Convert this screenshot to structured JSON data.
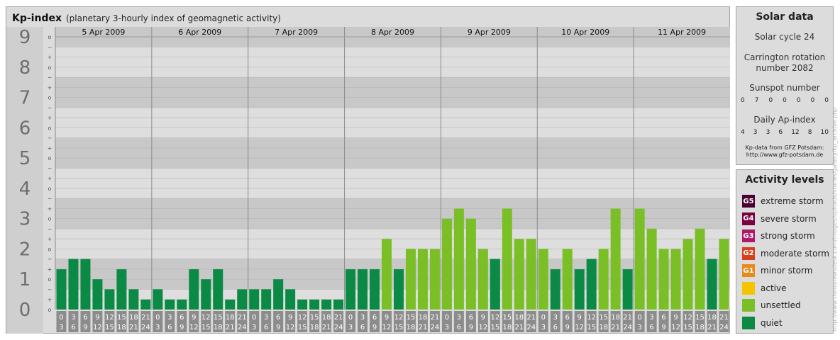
{
  "header": {
    "title": "Kp-index",
    "subtitle": "(planetary 3-hourly index of geomagnetic activity)"
  },
  "solar": {
    "title": "Solar data",
    "cycle": "Solar cycle 24",
    "carrington_l1": "Carrington rotation",
    "carrington_l2": "number 2082",
    "sunspot_label": "Sunspot number",
    "sunspot_values": [
      "0",
      "7",
      "0",
      "0",
      "0",
      "0",
      "0"
    ],
    "ap_label": "Daily Ap-index",
    "ap_values": [
      "4",
      "3",
      "3",
      "6",
      "12",
      "8",
      "10"
    ],
    "credit_l1": "Kp-data from GFZ Potsdam:",
    "credit_l2": "http://www.gfz-potsdam.de"
  },
  "levels": {
    "title": "Activity levels",
    "items": [
      {
        "badge": "G5",
        "label": "extreme storm",
        "color": "#4a0030"
      },
      {
        "badge": "G4",
        "label": "severe storm",
        "color": "#7a0040"
      },
      {
        "badge": "G3",
        "label": "strong storm",
        "color": "#b0186a"
      },
      {
        "badge": "G2",
        "label": "moderate storm",
        "color": "#d8401c"
      },
      {
        "badge": "G1",
        "label": "minor storm",
        "color": "#e88a1a"
      },
      {
        "badge": "",
        "label": "active",
        "color": "#f5c400"
      },
      {
        "badge": "",
        "label": "unsettled",
        "color": "#7abf26"
      },
      {
        "badge": "",
        "label": "quiet",
        "color": "#0a8a44"
      }
    ]
  },
  "watermark": "http://www.theusnewsdesk.com/images/uploads/stories/gallery/kp_archive.php",
  "chart_data": {
    "type": "bar",
    "days": [
      "5 Apr 2009",
      "6 Apr 2009",
      "7 Apr 2009",
      "8 Apr 2009",
      "9 Apr 2009",
      "10 Apr 2009",
      "11 Apr 2009"
    ],
    "y_ticks": [
      "0",
      "1",
      "2",
      "3",
      "4",
      "5",
      "6",
      "7",
      "8",
      "9"
    ],
    "y_subticks": [
      "o",
      "+",
      "−"
    ],
    "ylim": [
      0,
      9.33
    ],
    "hour_top": [
      "0",
      "3",
      "6",
      "9",
      "12",
      "15",
      "18",
      "21"
    ],
    "hour_bottom": [
      "3",
      "6",
      "9",
      "12",
      "15",
      "18",
      "21",
      "24"
    ],
    "quiet_color": "#0a8a44",
    "unsettled_color": "#7abf26",
    "values": [
      1.33,
      1.67,
      1.67,
      1.0,
      0.67,
      1.33,
      0.67,
      0.33,
      0.67,
      0.33,
      0.33,
      1.33,
      1.0,
      1.33,
      0.33,
      0.67,
      0.67,
      0.67,
      1.0,
      0.67,
      0.33,
      0.33,
      0.33,
      0.33,
      1.33,
      1.33,
      1.33,
      2.33,
      1.33,
      2.0,
      2.0,
      2.0,
      3.0,
      3.33,
      3.0,
      2.0,
      1.67,
      3.33,
      2.33,
      2.33,
      2.0,
      1.33,
      2.0,
      1.33,
      1.67,
      2.0,
      3.33,
      1.33,
      3.33,
      2.67,
      2.0,
      2.0,
      2.33,
      2.67,
      1.67,
      2.33
    ]
  }
}
